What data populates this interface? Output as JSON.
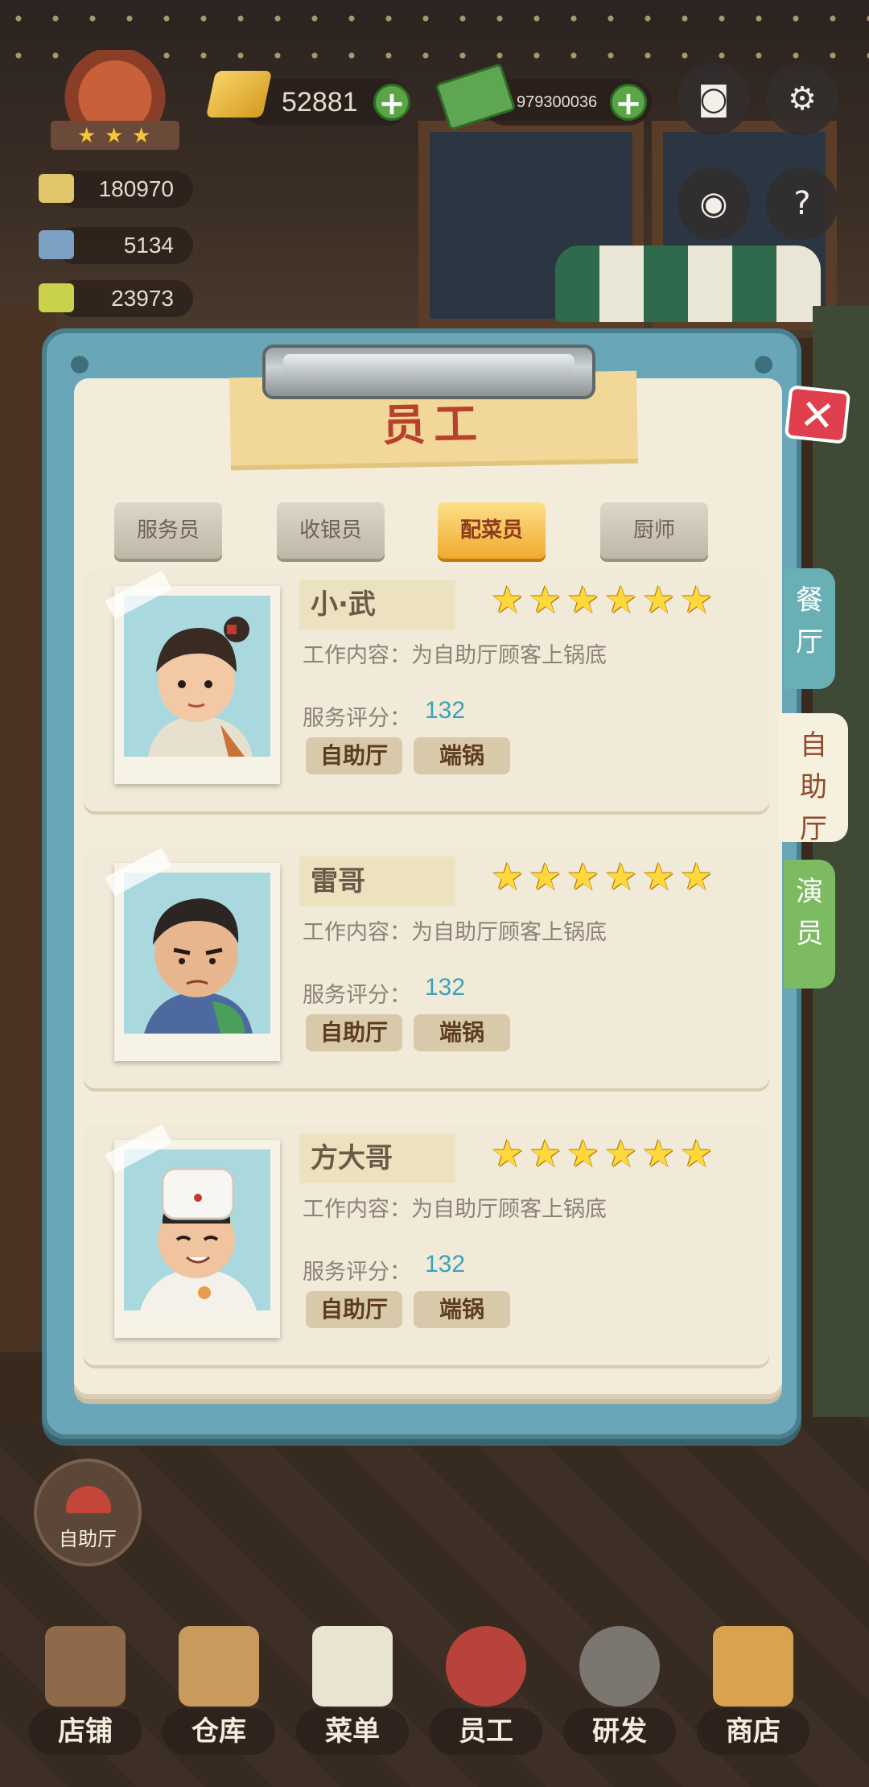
{
  "hud": {
    "gold": "52881",
    "cash": "979300036",
    "stats": [
      "180970",
      "5134",
      "23973"
    ]
  },
  "dialog": {
    "title": "员工",
    "close_label": "✕",
    "tabs": [
      {
        "label": "服务员",
        "active": false
      },
      {
        "label": "收银员",
        "active": false
      },
      {
        "label": "配菜员",
        "active": true
      },
      {
        "label": "厨师",
        "active": false
      }
    ],
    "side_tabs": [
      {
        "label": "餐厅",
        "active": false,
        "color": "#69b0b5"
      },
      {
        "label": "自助厅",
        "active": true,
        "color": "#f6f0de"
      },
      {
        "label": "演员",
        "active": false,
        "color": "#7dbb63"
      }
    ],
    "staff": [
      {
        "name": "小·武",
        "stars": 6,
        "job_label": "工作内容：",
        "job": "为自助厅顾客上锅底",
        "score_label": "服务评分：",
        "score": "132",
        "tags": [
          "自助厅",
          "端锅"
        ]
      },
      {
        "name": "雷哥",
        "stars": 6,
        "job_label": "工作内容：",
        "job": "为自助厅顾客上锅底",
        "score_label": "服务评分：",
        "score": "132",
        "tags": [
          "自助厅",
          "端锅"
        ]
      },
      {
        "name": "方大哥",
        "stars": 6,
        "job_label": "工作内容：",
        "job": "为自助厅顾客上锅底",
        "score_label": "服务评分：",
        "score": "132",
        "tags": [
          "自助厅",
          "端锅"
        ]
      }
    ]
  },
  "buffet_button": "自助厅",
  "nav": [
    "店铺",
    "仓库",
    "菜单",
    "员工",
    "研发",
    "商店"
  ],
  "colors": {
    "accent": "#f0aa2d",
    "panel": "#69a6b8",
    "title": "#b8412e"
  }
}
